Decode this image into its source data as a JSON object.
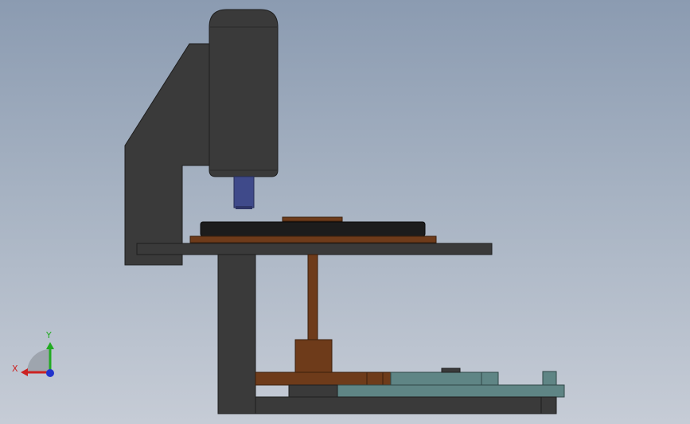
{
  "viewport": {
    "background_top": "#8b9bb1",
    "background_bottom": "#c6ccd6"
  },
  "model": {
    "part_colors": {
      "dark_steel": "#3a3a3a",
      "body_outline": "#1e1e1e",
      "objective_lens": "#3f4a8a",
      "wood_brown": "#6e3b1a",
      "wood_dark": "#5a2f14",
      "teal_plate": "#5f8585",
      "stage_black": "#1c1c1c"
    }
  },
  "triad": {
    "x_label": "X",
    "y_label": "Y",
    "x_color": "#cc2222",
    "y_color": "#22aa22",
    "origin_color": "#2233cc"
  }
}
